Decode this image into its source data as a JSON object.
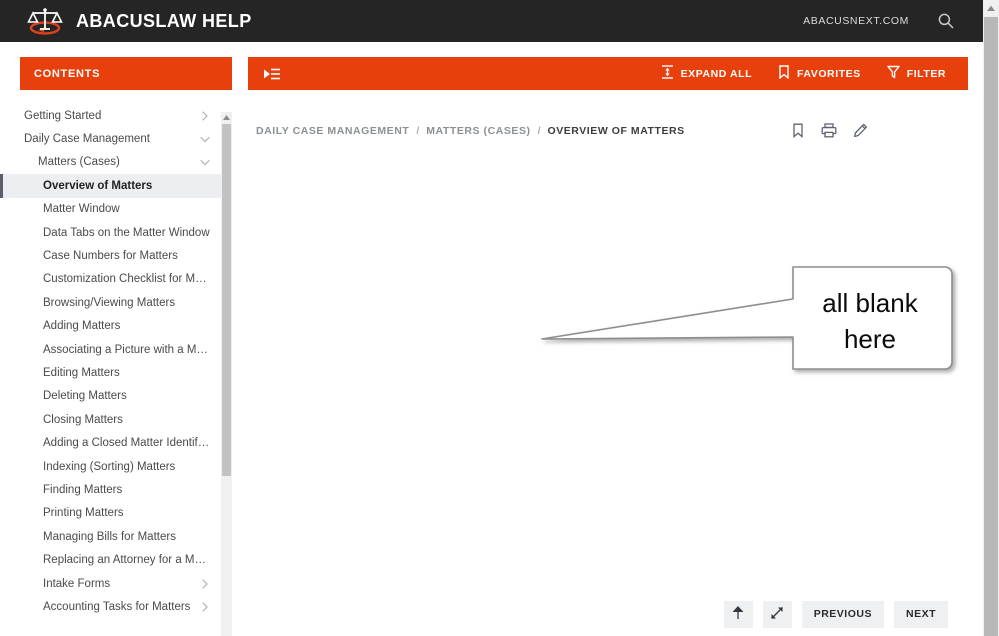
{
  "header": {
    "logo_alt": "scales-of-justice-logo",
    "title": "ABACUSLAW HELP",
    "site_link": "ABACUSNEXT.COM",
    "search_icon": "search-icon"
  },
  "toolbar": {
    "contents_label": "CONTENTS",
    "collapse_icon": "collapse-sidebar-icon",
    "actions": [
      {
        "label": "EXPAND ALL",
        "icon": "expand-all-icon"
      },
      {
        "label": "FAVORITES",
        "icon": "bookmark-icon"
      },
      {
        "label": "FILTER",
        "icon": "funnel-icon"
      }
    ]
  },
  "sidebar": {
    "items": [
      {
        "label": "Getting Started",
        "level": 0,
        "chevron": "right",
        "active": false
      },
      {
        "label": "Daily Case Management",
        "level": 0,
        "chevron": "down",
        "active": false
      },
      {
        "label": "Matters (Cases)",
        "level": 1,
        "chevron": "down",
        "active": false
      },
      {
        "label": "Overview of Matters",
        "level": 2,
        "chevron": "none",
        "active": true
      },
      {
        "label": "Matter Window",
        "level": 2,
        "chevron": "none",
        "active": false
      },
      {
        "label": "Data Tabs on the Matter Window",
        "level": 2,
        "chevron": "none",
        "active": false
      },
      {
        "label": "Case Numbers for Matters",
        "level": 2,
        "chevron": "none",
        "active": false
      },
      {
        "label": "Customization Checklist for Matters",
        "level": 2,
        "chevron": "none",
        "active": false
      },
      {
        "label": "Browsing/Viewing Matters",
        "level": 2,
        "chevron": "none",
        "active": false
      },
      {
        "label": "Adding Matters",
        "level": 2,
        "chevron": "none",
        "active": false
      },
      {
        "label": "Associating a Picture with a Matter",
        "level": 2,
        "chevron": "none",
        "active": false
      },
      {
        "label": "Editing Matters",
        "level": 2,
        "chevron": "none",
        "active": false
      },
      {
        "label": "Deleting Matters",
        "level": 2,
        "chevron": "none",
        "active": false
      },
      {
        "label": "Closing Matters",
        "level": 2,
        "chevron": "none",
        "active": false
      },
      {
        "label": "Adding a Closed Matter Identifier",
        "level": 2,
        "chevron": "none",
        "active": false
      },
      {
        "label": "Indexing (Sorting) Matters",
        "level": 2,
        "chevron": "none",
        "active": false
      },
      {
        "label": "Finding Matters",
        "level": 2,
        "chevron": "none",
        "active": false
      },
      {
        "label": "Printing Matters",
        "level": 2,
        "chevron": "none",
        "active": false
      },
      {
        "label": "Managing Bills for Matters",
        "level": 2,
        "chevron": "none",
        "active": false
      },
      {
        "label": "Replacing an Attorney for a Matter",
        "level": 2,
        "chevron": "none",
        "active": false
      },
      {
        "label": "Intake Forms",
        "level": 2,
        "chevron": "right",
        "active": false
      },
      {
        "label": "Accounting Tasks for Matters",
        "level": 2,
        "chevron": "right",
        "active": false
      }
    ]
  },
  "breadcrumb": {
    "separator": "/",
    "items": [
      {
        "label": "DAILY CASE MANAGEMENT",
        "current": false
      },
      {
        "label": "MATTERS (CASES)",
        "current": false
      },
      {
        "label": "OVERVIEW OF MATTERS",
        "current": true
      }
    ],
    "actions": [
      {
        "icon": "bookmark-icon",
        "name": "bookmark-page-button"
      },
      {
        "icon": "printer-icon",
        "name": "print-page-button"
      },
      {
        "icon": "pencil-icon",
        "name": "edit-page-button"
      }
    ]
  },
  "content": {
    "callout_text": "all blank here",
    "callout_line1": "all blank",
    "callout_line2": "here"
  },
  "footer": {
    "scroll_top_icon": "arrow-up-icon",
    "expand_icon": "expand-diagonal-icon",
    "previous_label": "PREVIOUS",
    "next_label": "NEXT"
  },
  "colors": {
    "accent_orange": "#e8400c",
    "header_dark": "#252525",
    "active_item_bg": "#eceef1",
    "button_bg": "#eef0f2"
  }
}
